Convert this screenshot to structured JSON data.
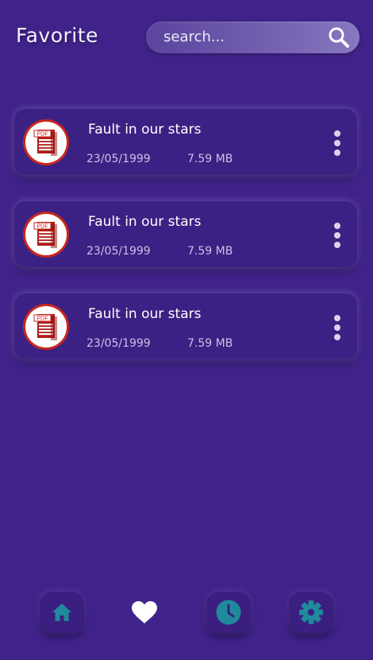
{
  "header": {
    "title": "Favorite"
  },
  "search": {
    "placeholder": "search...",
    "icon": "search-icon"
  },
  "files": [
    {
      "name": "Fault in our stars",
      "date": "23/05/1999",
      "size": "7.59 MB",
      "icon": "pdf-icon"
    },
    {
      "name": "Fault in our stars",
      "date": "23/05/1999",
      "size": "7.59 MB",
      "icon": "pdf-icon"
    },
    {
      "name": "Fault in our stars",
      "date": "23/05/1999",
      "size": "7.59 MB",
      "icon": "pdf-icon"
    }
  ],
  "pdf_badge": "PDF",
  "bottom_nav": {
    "items": [
      {
        "icon": "home-icon",
        "active": false
      },
      {
        "icon": "heart-icon",
        "active": true
      },
      {
        "icon": "clock-icon",
        "active": false
      },
      {
        "icon": "gear-icon",
        "active": false
      }
    ]
  },
  "colors": {
    "background": "#40238a",
    "accent": "#1f8a9c",
    "pdf_red": "#c8261f",
    "text_secondary": "#c9c2e6"
  }
}
